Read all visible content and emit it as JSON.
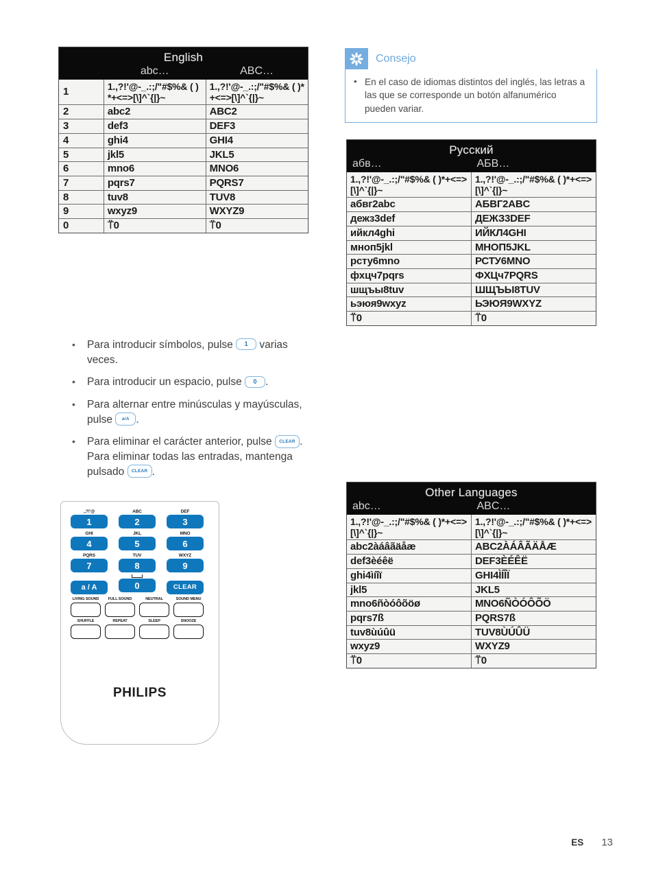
{
  "page": {
    "locale_code": "ES",
    "page_number": "13"
  },
  "colors": {
    "accent_blue": "#0f78bd",
    "tip_blue": "#74ade0",
    "tip_text_blue": "#6ea8dd",
    "table_header_bg": "#0a0a0a"
  },
  "english_table": {
    "title": "English",
    "sub_lower": "abc…",
    "sub_upper": "ABC…",
    "rows": [
      {
        "key": "1",
        "lower": "1.,?!'@-_.:;/\"#$%& ( )*+<=>[\\]^`{|}~",
        "upper": "1.,?!'@-_.:;/\"#$%& ( )*+<=>[\\]^`{|}~"
      },
      {
        "key": "2",
        "lower": "abc2",
        "upper": "ABC2"
      },
      {
        "key": "3",
        "lower": "def3",
        "upper": "DEF3"
      },
      {
        "key": "4",
        "lower": "ghi4",
        "upper": "GHI4"
      },
      {
        "key": "5",
        "lower": "jkl5",
        "upper": "JKL5"
      },
      {
        "key": "6",
        "lower": "mno6",
        "upper": "MNO6"
      },
      {
        "key": "7",
        "lower": "pqrs7",
        "upper": "PQRS7"
      },
      {
        "key": "8",
        "lower": "tuv8",
        "upper": "TUV8"
      },
      {
        "key": "9",
        "lower": "wxyz9",
        "upper": "WXYZ9"
      },
      {
        "key": "0",
        "lower": "⍡0",
        "upper": "⍡0"
      }
    ]
  },
  "russian_table": {
    "title": "Русский",
    "sub_lower": "абв…",
    "sub_upper": "АБВ…",
    "rows": [
      {
        "lower": "1.,?!'@-_.:;/\"#$%& ( )*+<=>[\\]^`{|}~",
        "upper": "1.,?!'@-_.:;/\"#$%& ( )*+<=>[\\]^`{|}~"
      },
      {
        "lower": "абвг2abc",
        "upper": "АБВГ2ABC"
      },
      {
        "lower": "дежз3def",
        "upper": "ДЕЖЗ3DEF"
      },
      {
        "lower": "ийкл4ghi",
        "upper": "ИЙКЛ4GHI"
      },
      {
        "lower": "мноп5jkl",
        "upper": "МНОП5JKL"
      },
      {
        "lower": "рсту6mno",
        "upper": "РСТУ6MNO"
      },
      {
        "lower": "фхцч7pqrs",
        "upper": "ФХЦч7PQRS"
      },
      {
        "lower": "шщъы8tuv",
        "upper": "ШЩЪЫ8TUV"
      },
      {
        "lower": "ьэюя9wxyz",
        "upper": "ЬЭЮЯ9WXYZ"
      },
      {
        "lower": "⍡0",
        "upper": "⍡0"
      }
    ]
  },
  "other_table": {
    "title": "Other Languages",
    "sub_lower": "abc…",
    "sub_upper": "ABC…",
    "rows": [
      {
        "lower": "1.,?!'@-_.:;/\"#$%& ( )*+<=>[\\]^`{|}~",
        "upper": "1.,?!'@-_.:;/\"#$%& ( )*+<=>[\\]^`{|}~"
      },
      {
        "lower": "abc2àáâãäåæ",
        "upper": "ABC2ÀÁÂÃÄÅÆ"
      },
      {
        "lower": "def3èéêë",
        "upper": "DEF3ÈÉÊË"
      },
      {
        "lower": "ghi4ìíîï",
        "upper": "GHI4ÌÍÎÏ"
      },
      {
        "lower": "jkl5",
        "upper": "JKL5"
      },
      {
        "lower": "mno6ñòóôõöø",
        "upper": "MNO6ÑÒÓÔÕÖ"
      },
      {
        "lower": "pqrs7ß",
        "upper": "PQRS7ß"
      },
      {
        "lower": "tuv8ùúûü",
        "upper": "TUV8ÙÚÛÜ"
      },
      {
        "lower": "wxyz9",
        "upper": "WXYZ9"
      },
      {
        "lower": "⍡0",
        "upper": "⍡0"
      }
    ]
  },
  "bullets": [
    {
      "parts": [
        {
          "t": "text",
          "v": "Para introducir símbolos, pulse "
        },
        {
          "t": "key",
          "v": "1",
          "style": "num"
        },
        {
          "t": "text",
          "v": " varias veces."
        }
      ]
    },
    {
      "parts": [
        {
          "t": "text",
          "v": "Para introducir un espacio, pulse "
        },
        {
          "t": "key",
          "v": "0",
          "style": "num"
        },
        {
          "t": "text",
          "v": "."
        }
      ]
    },
    {
      "parts": [
        {
          "t": "text",
          "v": "Para alternar entre minúsculas y mayúsculas, pulse "
        },
        {
          "t": "key",
          "v": "a/A",
          "style": "aA"
        },
        {
          "t": "text",
          "v": "."
        }
      ]
    },
    {
      "parts": [
        {
          "t": "text",
          "v": "Para eliminar el carácter anterior, pulse "
        },
        {
          "t": "key",
          "v": "CLEAR",
          "style": "clear"
        },
        {
          "t": "text",
          "v": ". Para eliminar todas las entradas, mantenga pulsado "
        },
        {
          "t": "key",
          "v": "CLEAR",
          "style": "clear"
        },
        {
          "t": "text",
          "v": "."
        }
      ]
    }
  ],
  "tip": {
    "label": "Consejo",
    "text": "En el caso de idiomas distintos del inglés, las letras a las que se corresponde un botón alfanumérico pueden variar."
  },
  "remote": {
    "brand": "PHILIPS",
    "numeric_rows": [
      [
        {
          "label": ".,?!'@",
          "key": "1"
        },
        {
          "label": "ABC",
          "key": "2"
        },
        {
          "label": "DEF",
          "key": "3"
        }
      ],
      [
        {
          "label": "GHI",
          "key": "4"
        },
        {
          "label": "JKL",
          "key": "5"
        },
        {
          "label": "MNO",
          "key": "6"
        }
      ],
      [
        {
          "label": "PQRS",
          "key": "7"
        },
        {
          "label": "TUV",
          "key": "8"
        },
        {
          "label": "WXYZ",
          "key": "9"
        }
      ]
    ],
    "bottom_row": [
      {
        "label": "",
        "key": "a / A"
      },
      {
        "label": "space",
        "key": "0"
      },
      {
        "label": "",
        "key": "CLEAR"
      }
    ],
    "sound_rows": [
      [
        {
          "label": "LIVING SOUND"
        },
        {
          "label": "FULL SOUND"
        },
        {
          "label": "NEUTRAL"
        },
        {
          "label": "SOUND MENU"
        }
      ],
      [
        {
          "label": "SHUFFLE"
        },
        {
          "label": "REPEAT"
        },
        {
          "label": "SLEEP"
        },
        {
          "label": "SNOOZE"
        }
      ]
    ]
  }
}
